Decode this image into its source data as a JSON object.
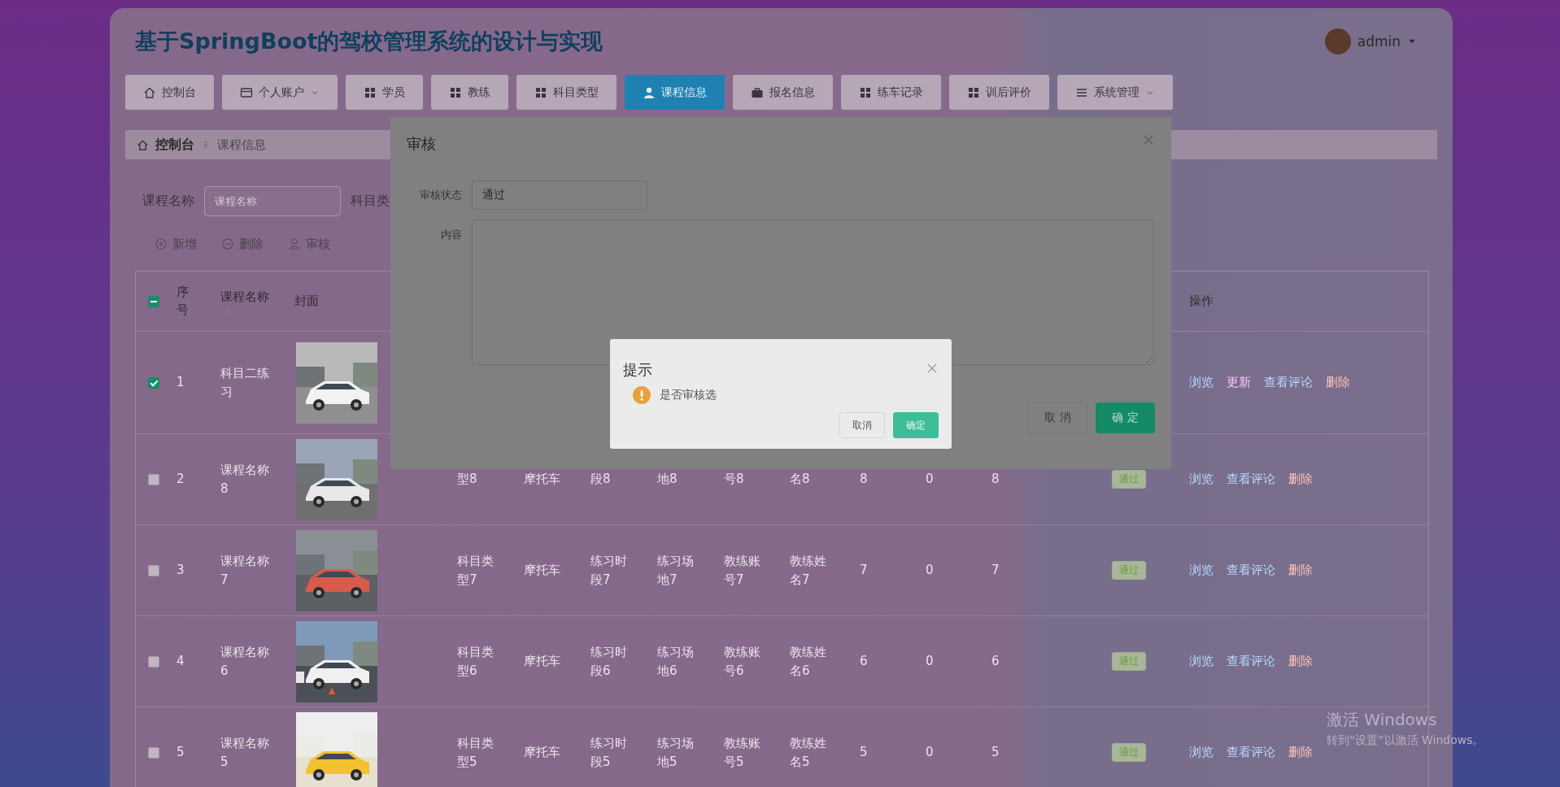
{
  "header": {
    "title": "基于SpringBoot的驾校管理系统的设计与实现",
    "user": {
      "name": "admin"
    }
  },
  "nav": [
    {
      "label": "控制台",
      "selected": false,
      "dropdown": false
    },
    {
      "label": "个人账户",
      "selected": false,
      "dropdown": true
    },
    {
      "label": "学员",
      "selected": false,
      "dropdown": false
    },
    {
      "label": "教练",
      "selected": false,
      "dropdown": false
    },
    {
      "label": "科目类型",
      "selected": false,
      "dropdown": false
    },
    {
      "label": "课程信息",
      "selected": true,
      "dropdown": false
    },
    {
      "label": "报名信息",
      "selected": false,
      "dropdown": false
    },
    {
      "label": "练车记录",
      "selected": false,
      "dropdown": false
    },
    {
      "label": "训后评价",
      "selected": false,
      "dropdown": false
    },
    {
      "label": "系统管理",
      "selected": false,
      "dropdown": true
    }
  ],
  "breadcrumb": [
    {
      "label": "控制台"
    },
    {
      "label": "课程信息"
    }
  ],
  "search": [
    {
      "label": "课程名称",
      "placeholder": "课程名称"
    },
    {
      "label": "科目类"
    }
  ],
  "toolbar": [
    {
      "label": "新增"
    },
    {
      "label": "删除"
    },
    {
      "label": "审核"
    }
  ],
  "table": {
    "select_all": {
      "indeterminate": true
    },
    "columns": [
      {
        "label": "序号",
        "sortable": false
      },
      {
        "label": "课程名称",
        "sortable": true
      },
      {
        "label": "封面",
        "sortable": true
      },
      {
        "label": "操作",
        "sortable": false
      }
    ],
    "rows": [
      {
        "selected": true,
        "index": "1",
        "name": "科目二练习",
        "cover": {
          "kind": "picture"
        },
        "actions": [
          {
            "label": "浏览",
            "kind": "view"
          },
          {
            "label": "更新",
            "kind": "edit"
          },
          {
            "label": "查看评论",
            "kind": "view"
          },
          {
            "label": "删除",
            "kind": "delete"
          }
        ]
      },
      {
        "selected": false,
        "index": "2",
        "name": "课程名称8",
        "cover": {
          "kind": "picture"
        },
        "cells": [
          "型8",
          "摩托车",
          "段8",
          "地8",
          "号8",
          "名8",
          "8",
          "0",
          "8"
        ],
        "status": "通过",
        "actions": [
          {
            "label": "浏览",
            "kind": "view"
          },
          {
            "label": "查看评论",
            "kind": "view"
          },
          {
            "label": "删除",
            "kind": "delete"
          }
        ]
      },
      {
        "selected": false,
        "index": "3",
        "name": "课程名称7",
        "cover": {
          "kind": "picture"
        },
        "cells": [
          "科目类型7",
          "摩托车",
          "练习时段7",
          "练习场地7",
          "教练账号7",
          "教练姓名7",
          "7",
          "0",
          "7"
        ],
        "status": "通过",
        "actions": [
          {
            "label": "浏览",
            "kind": "view"
          },
          {
            "label": "查看评论",
            "kind": "view"
          },
          {
            "label": "删除",
            "kind": "delete"
          }
        ]
      },
      {
        "selected": false,
        "index": "4",
        "name": "课程名称6",
        "cover": {
          "kind": "picture"
        },
        "cells": [
          "科目类型6",
          "摩托车",
          "练习时段6",
          "练习场地6",
          "教练账号6",
          "教练姓名6",
          "6",
          "0",
          "6"
        ],
        "status": "通过",
        "actions": [
          {
            "label": "浏览",
            "kind": "view"
          },
          {
            "label": "查看评论",
            "kind": "view"
          },
          {
            "label": "删除",
            "kind": "delete"
          }
        ]
      },
      {
        "selected": false,
        "index": "5",
        "name": "课程名称5",
        "cover": {
          "kind": "picture"
        },
        "cells": [
          "科目类型5",
          "摩托车",
          "练习时段5",
          "练习场地5",
          "教练账号5",
          "教练姓名5",
          "5",
          "0",
          "5"
        ],
        "status": "通过",
        "actions": [
          {
            "label": "浏览",
            "kind": "view"
          },
          {
            "label": "查看评论",
            "kind": "view"
          },
          {
            "label": "删除",
            "kind": "delete"
          }
        ]
      }
    ]
  },
  "audit_dialog": {
    "title": "审核",
    "fields": [
      {
        "label": "审核状态",
        "kind": "select",
        "value": "通过"
      },
      {
        "label": "内容",
        "kind": "textarea"
      }
    ],
    "buttons": [
      {
        "label": "取 消",
        "primary": false
      },
      {
        "label": "确 定",
        "primary": true
      }
    ]
  },
  "message_box": {
    "title": "提示",
    "message": "是否审核选",
    "buttons": [
      {
        "label": "取消",
        "primary": false
      },
      {
        "label": "确定",
        "primary": true
      }
    ]
  },
  "os_notice": {
    "title": "激活 Windows",
    "text": "转到“设置”以激活 Windows。"
  }
}
